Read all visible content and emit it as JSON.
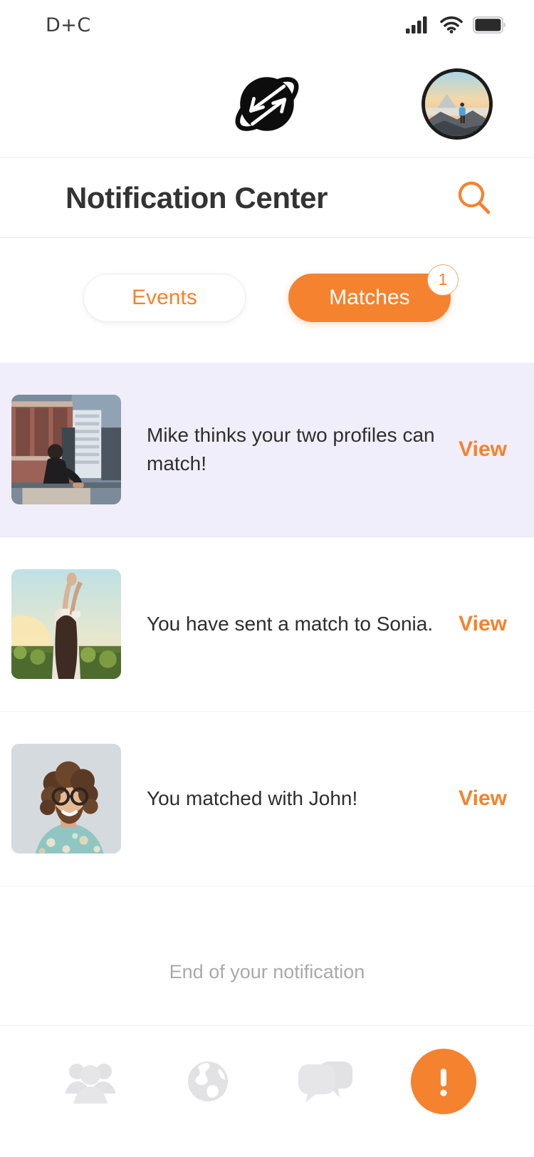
{
  "status_bar": {
    "carrier": "D+C",
    "signal_icon": "cellular-signal-icon",
    "wifi_icon": "wifi-icon",
    "battery_icon": "battery-icon"
  },
  "app_bar": {
    "logo_icon": "app-logo-exchange-arrows-icon",
    "avatar_alt": "user-avatar-mountain-hiker"
  },
  "header": {
    "title": "Notification Center",
    "search_icon": "search-icon"
  },
  "tabs": [
    {
      "label": "Events",
      "active": false,
      "badge": null
    },
    {
      "label": "Matches",
      "active": true,
      "badge": "1"
    }
  ],
  "notifications": [
    {
      "message": "Mike thinks your two profiles can match!",
      "action_label": "View",
      "unread": true,
      "thumb": "man-sitting-rooftop-city"
    },
    {
      "message": "You have sent a match to Sonia.",
      "action_label": "View",
      "unread": false,
      "thumb": "woman-arms-raised-sunflower-field"
    },
    {
      "message": "You matched with John!",
      "action_label": "View",
      "unread": false,
      "thumb": "man-curly-hair-glasses-floral-shirt"
    }
  ],
  "list_end": {
    "text": "End of your notification"
  },
  "bottom_nav": [
    {
      "icon": "people-group-icon",
      "active": false
    },
    {
      "icon": "globe-icon",
      "active": false
    },
    {
      "icon": "chat-bubbles-icon",
      "active": false
    },
    {
      "icon": "alert-exclamation-icon",
      "active": true
    }
  ],
  "colors": {
    "accent": "#F5822E",
    "unread_row_bg": "#F1EEFB",
    "title_text": "#333333",
    "muted_text": "#A9A9AD",
    "nav_inactive": "#E2E2E4"
  }
}
